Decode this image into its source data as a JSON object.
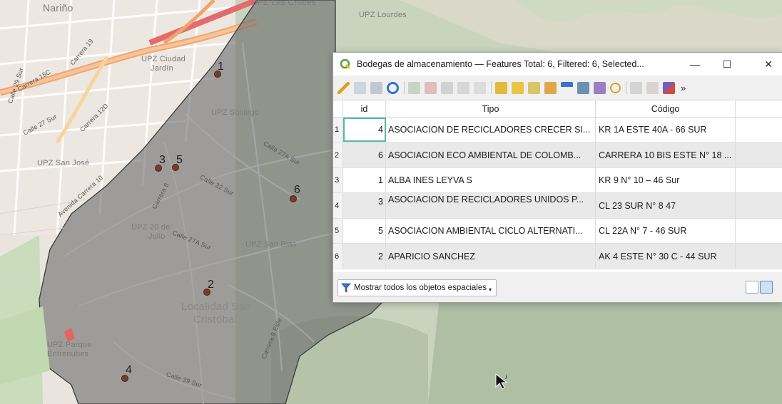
{
  "map": {
    "labels": {
      "narino": "Nariño",
      "upz_las_cruces": "UPZ Las Cruces",
      "upz_lourdes": "UPZ Lourdes",
      "upz_ciudad_jardin_1": "UPZ Ciudad",
      "upz_ciudad_jardin_2": "Jardín",
      "upz_sosiego": "UPZ Sosiego",
      "upz_san_jose": "UPZ San José",
      "upz_20_julio_1": "UPZ 20 de",
      "upz_20_julio_2": "Julio",
      "upz_san_blas": "UPZ San Blas",
      "localidad_1": "Localidad San",
      "localidad_2": "Cristóbal",
      "upz_parque_1": "UPZ Parque",
      "upz_parque_2": "Entrenubes",
      "calle_27_sur": "Calle 27 Sur",
      "carrera_12d": "Carrera 12D",
      "carrera_15c": "Carrera 15C",
      "carrera_19": "Carrera 19",
      "calle_29_sur": "Calle 29 Sur",
      "calle_27a_sur": "Calle 27A Sur",
      "calle_22_sur": "Calle 22 Sur",
      "calle_27a_sur_2": "Calle 27A Sur",
      "avenida_carrera_10": "Avenida Carrera 10",
      "calle_39_sur": "Calle 39 Sur",
      "carrera_9_este": "Carrera 9 Este",
      "carrera_8": "Carrera 8"
    },
    "points": [
      {
        "label": "1"
      },
      {
        "label": "2"
      },
      {
        "label": "3"
      },
      {
        "label": "4"
      },
      {
        "label": "5"
      },
      {
        "label": "6"
      }
    ],
    "colors": {
      "polygon_fill": "#6b6b6b",
      "polygon_stroke": "#3a3a3a",
      "point": "#7a3a2a"
    }
  },
  "window": {
    "title": "Bodegas de almacenamiento — Features Total: 6, Filtered: 6, Selected...",
    "minimize_label": "—",
    "maximize_label": "☐",
    "close_label": "✕",
    "more_label": "»"
  },
  "table": {
    "headers": [
      "id",
      "Tipo",
      "Código"
    ],
    "rows": [
      {
        "n": "1",
        "id": "4",
        "tipo": "ASOCIACION DE RECICLADORES CRECER SI...",
        "codigo": "KR 1A ESTE 40A - 66 SUR"
      },
      {
        "n": "2",
        "id": "6",
        "tipo": "ASOCIACION ECO AMBIENTAL DE COLOMB...",
        "codigo": "CARRERA 10 BIS ESTE N° 18 ..."
      },
      {
        "n": "3",
        "id": "1",
        "tipo": "ALBA INES LEYVA S",
        "codigo": "KR 9 N° 10 – 46 Sur"
      },
      {
        "n": "4",
        "id": "3",
        "tipo": "ASOCIACION DE RECICLADORES UNIDOS P...",
        "codigo": "CL 23 SUR N° 8 47"
      },
      {
        "n": "5",
        "id": "5",
        "tipo": "ASOCIACION AMBIENTAL CICLO ALTERNATI...",
        "codigo": "CL 22A N° 7 - 46 SUR"
      },
      {
        "n": "6",
        "id": "2",
        "tipo": "APARICIO SANCHEZ",
        "codigo": "AK 4 ESTE N° 30 C - 44 SUR"
      }
    ]
  },
  "bottom": {
    "filter_label": "Mostrar todos los objetos espaciales"
  }
}
